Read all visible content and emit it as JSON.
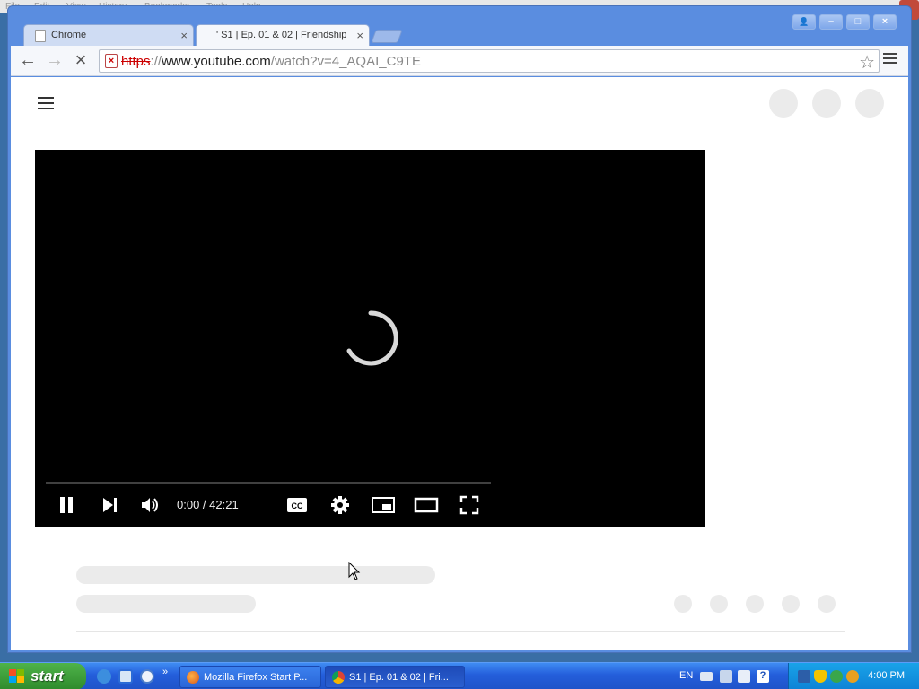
{
  "background_window": {
    "menu": [
      "File",
      "Edit",
      "View",
      "History",
      "Bookmarks",
      "Tools",
      "Help"
    ]
  },
  "tabs": [
    {
      "label": "Chrome",
      "close": "×"
    },
    {
      "label": "' S1 | Ep. 01 & 02 | Friendship",
      "close": "×"
    }
  ],
  "window_controls": {
    "user": "👤",
    "minimize": "–",
    "maximize": "□",
    "close": "×"
  },
  "toolbar": {
    "back": "←",
    "forward": "→",
    "stop": "×",
    "url_scheme": "https",
    "url_sep": "://",
    "url_host": "www.youtube.com",
    "url_path": "/watch?v=4_AQAI_C9TE",
    "bookmark_star": "☆"
  },
  "player": {
    "time": "0:00 / 42:21",
    "progress": 0
  },
  "taskbar": {
    "start_label": "start",
    "tasks": [
      {
        "label": "Mozilla Firefox Start P..."
      },
      {
        "label": "S1 | Ep. 01 & 02 | Fri..."
      }
    ],
    "language": "EN",
    "clock": "4:00 PM"
  },
  "colors": {
    "player_bg": "#000000",
    "skeleton": "#ebebeb",
    "taskbar_blue": "#245edb",
    "start_green": "#3a9b36"
  }
}
